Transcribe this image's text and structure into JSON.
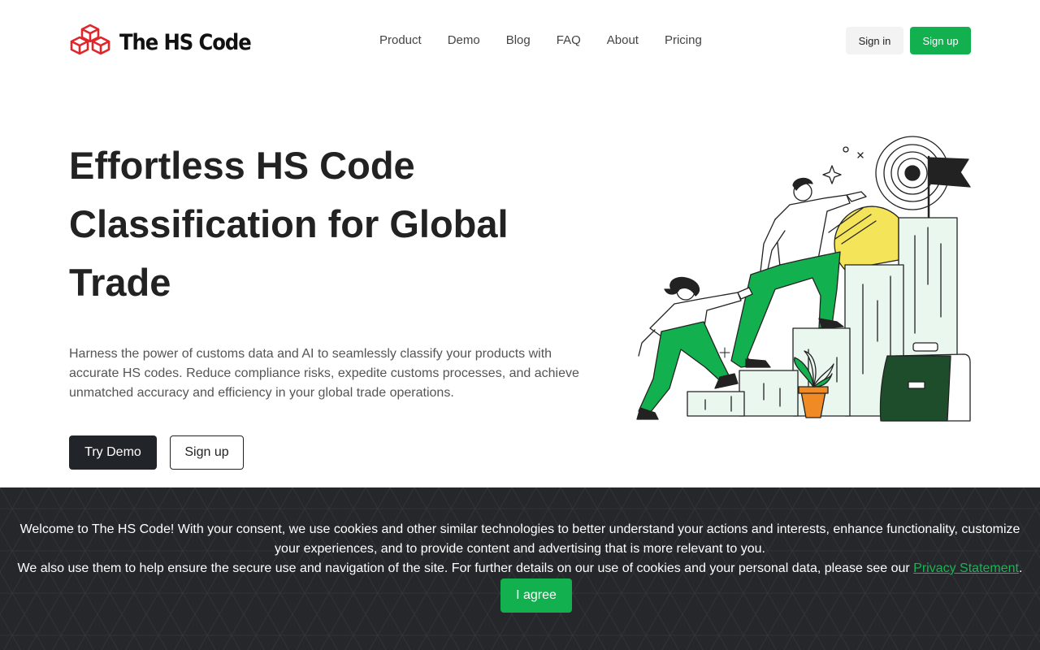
{
  "brand": {
    "name": "The HS Code",
    "logo_color": "#e0262b"
  },
  "nav": {
    "items": [
      {
        "label": "Product"
      },
      {
        "label": "Demo"
      },
      {
        "label": "Blog"
      },
      {
        "label": "FAQ"
      },
      {
        "label": "About"
      },
      {
        "label": "Pricing"
      }
    ],
    "sign_in_label": "Sign in",
    "sign_up_label": "Sign up"
  },
  "hero": {
    "title": "Effortless HS Code Classification for Global Trade",
    "description": "Harness the power of customs data and AI to seamlessly classify your products with accurate HS codes. Reduce compliance risks, expedite customs processes, and achieve unmatched accuracy and efficiency in your global trade operations.",
    "try_demo_label": "Try Demo",
    "sign_up_label": "Sign up"
  },
  "cookie_banner": {
    "text_line1": "Welcome to The HS Code! With your consent, we use cookies and other similar technologies to better understand your actions and interests, enhance functionality, customize your experiences, and to provide content and advertising that is more relevant to you.",
    "text_line2_prefix": "We also use them to help ensure the secure use and navigation of the site. For further details on our use of cookies and your personal data, please see our",
    "privacy_link_label": "Privacy Statement",
    "text_line2_suffix": ".",
    "agree_label": "I agree"
  },
  "colors": {
    "accent_green": "#13b04f",
    "dark_button": "#212529",
    "banner_background": "#25272b",
    "illustration_yellow": "#f3e45a",
    "illustration_orange": "#f08a24",
    "illustration_dark_green": "#1e4d2b"
  },
  "icons": {
    "logo": "stacked-cubes-icon",
    "illustration": "people-climbing-steps-to-target-illustration"
  }
}
